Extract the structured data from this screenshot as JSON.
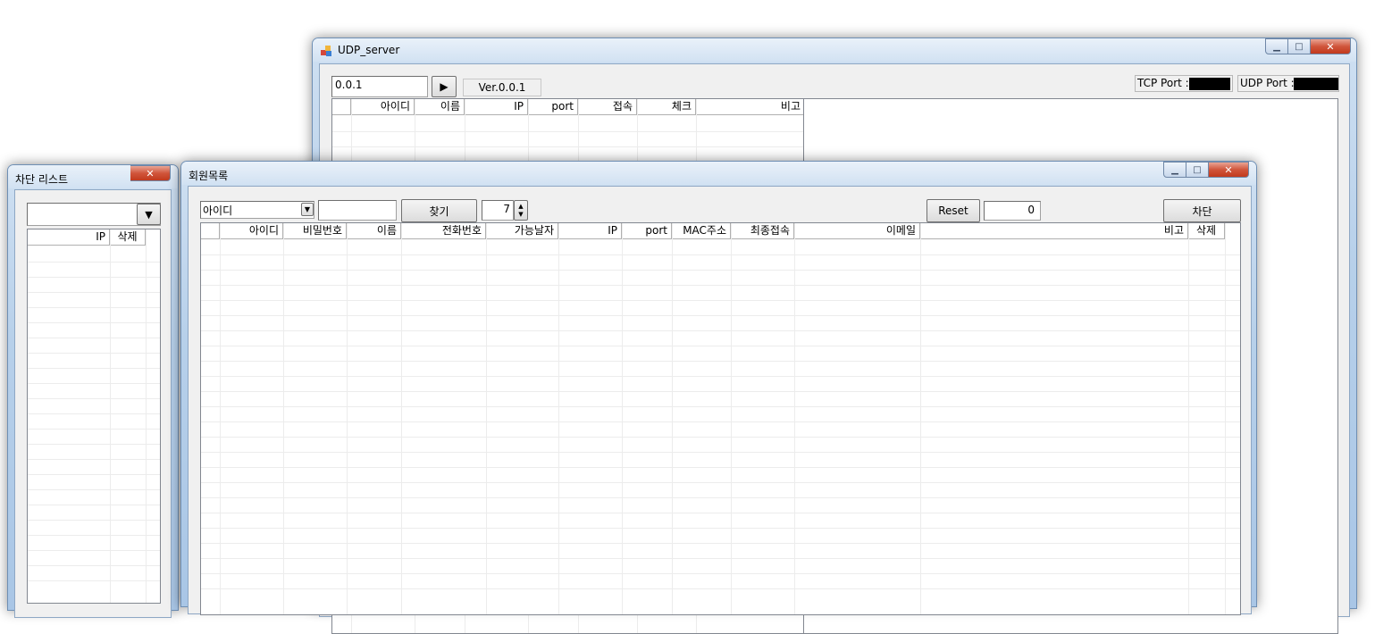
{
  "server": {
    "title": "UDP_server",
    "ip_value": "0.0.1",
    "play_label": "▶",
    "version": "Ver.0.0.1",
    "tcp_label": "TCP Port :",
    "udp_label": "UDP Port :",
    "columns": [
      "아이디",
      "이름",
      "IP",
      "port",
      "접속",
      "체크",
      "비고"
    ]
  },
  "block_list": {
    "title": "차단 리스트",
    "dropdown_value": "",
    "columns": [
      "IP",
      "삭제"
    ]
  },
  "members": {
    "title": "회원목록",
    "search_field": "아이디",
    "search_text": "",
    "find_label": "찾기",
    "days_value": "7",
    "reset_label": "Reset",
    "count_value": "0",
    "block_label": "차단",
    "columns": [
      "아이디",
      "비밀번호",
      "이름",
      "전화번호",
      "가능날자",
      "IP",
      "port",
      "MAC주소",
      "최종접속",
      "이메일",
      "비고",
      "삭제"
    ]
  },
  "icons": {
    "app": "app-icon",
    "dropdown": "dropdown-arrow-icon",
    "spin": "spinner-arrows-icon"
  }
}
